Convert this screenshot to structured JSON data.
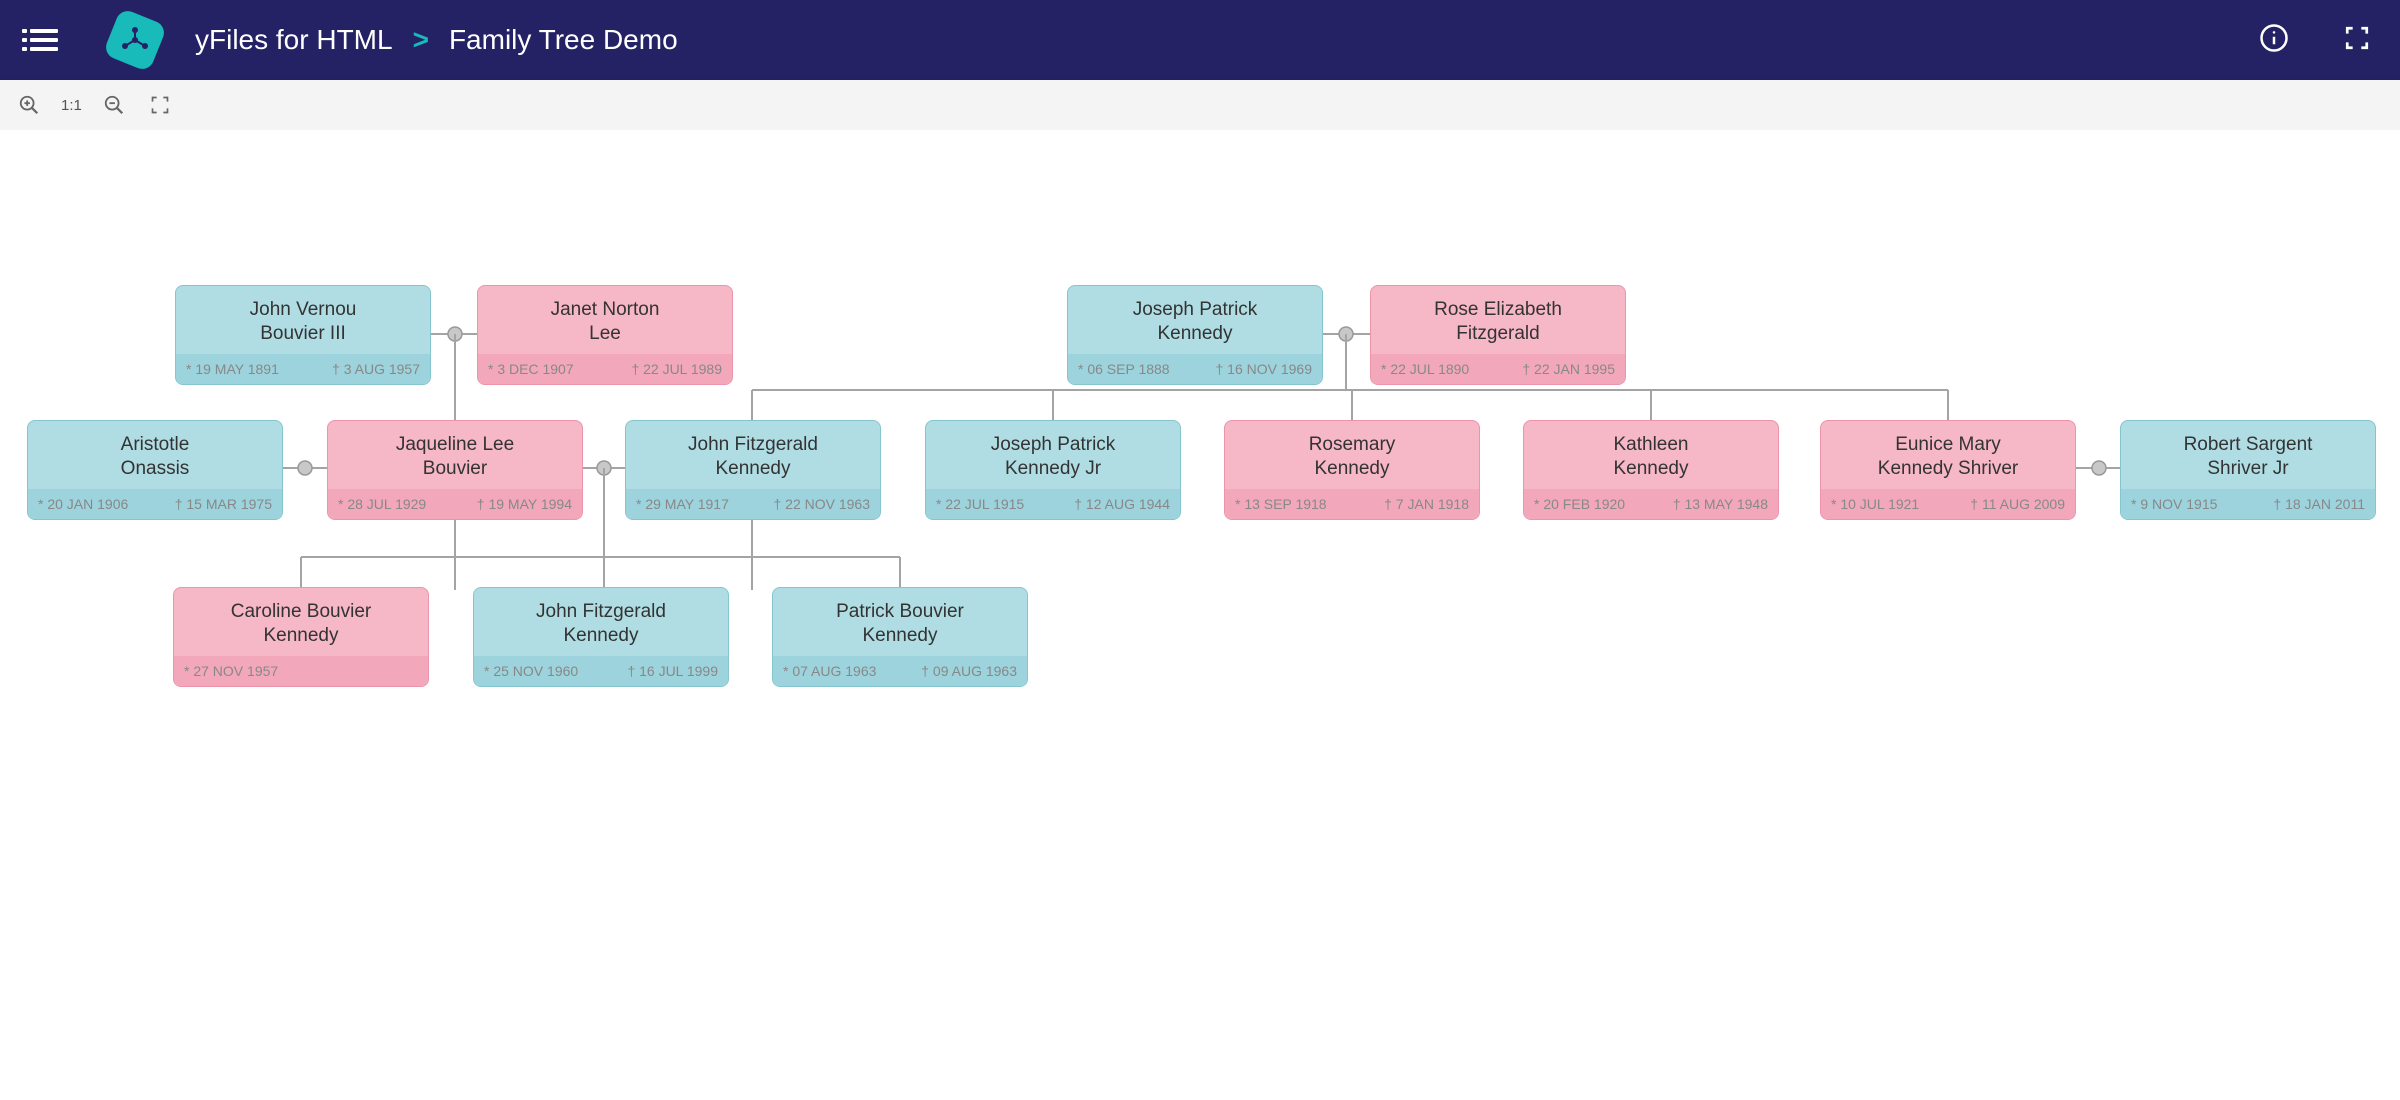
{
  "header": {
    "product": "yFiles for HTML",
    "separator": ">",
    "page": "Family Tree Demo"
  },
  "toolbar": {
    "zoom_reset": "1:1"
  },
  "people": {
    "john_bouvier": {
      "name1": "John Vernou",
      "name2": "Bouvier III",
      "birth": "* 19 MAY 1891",
      "death": "† 3 AUG 1957"
    },
    "janet_lee": {
      "name1": "Janet Norton",
      "name2": "Lee",
      "birth": "* 3 DEC 1907",
      "death": "† 22 JUL 1989"
    },
    "joseph_kennedy_sr": {
      "name1": "Joseph Patrick",
      "name2": "Kennedy",
      "birth": "* 06 SEP 1888",
      "death": "† 16 NOV 1969"
    },
    "rose_fitzgerald": {
      "name1": "Rose Elizabeth",
      "name2": "Fitzgerald",
      "birth": "* 22 JUL 1890",
      "death": "† 22 JAN 1995"
    },
    "aristotle_onassis": {
      "name1": "Aristotle",
      "name2": "Onassis",
      "birth": "* 20 JAN 1906",
      "death": "† 15 MAR 1975"
    },
    "jackie": {
      "name1": "Jaqueline Lee",
      "name2": "Bouvier",
      "birth": "* 28 JUL 1929",
      "death": "† 19 MAY 1994"
    },
    "jfk": {
      "name1": "John Fitzgerald",
      "name2": "Kennedy",
      "birth": "* 29 MAY 1917",
      "death": "† 22 NOV 1963"
    },
    "joe_jr": {
      "name1": "Joseph Patrick",
      "name2": "Kennedy Jr",
      "birth": "* 22 JUL 1915",
      "death": "† 12 AUG 1944"
    },
    "rosemary": {
      "name1": "Rosemary",
      "name2": "Kennedy",
      "birth": "* 13 SEP 1918",
      "death": "† 7 JAN 1918"
    },
    "kathleen": {
      "name1": "Kathleen",
      "name2": "Kennedy",
      "birth": "* 20 FEB 1920",
      "death": "† 13 MAY 1948"
    },
    "eunice": {
      "name1": "Eunice Mary",
      "name2": "Kennedy Shriver",
      "birth": "* 10 JUL 1921",
      "death": "† 11 AUG 2009"
    },
    "shriver": {
      "name1": "Robert Sargent",
      "name2": "Shriver Jr",
      "birth": "* 9 NOV 1915",
      "death": "† 18 JAN 2011"
    },
    "caroline": {
      "name1": "Caroline Bouvier",
      "name2": "Kennedy",
      "birth": "* 27 NOV 1957",
      "death": ""
    },
    "jfk_jr": {
      "name1": "John Fitzgerald",
      "name2": "Kennedy",
      "birth": "* 25 NOV 1960",
      "death": "† 16 JUL 1999"
    },
    "patrick": {
      "name1": "Patrick Bouvier",
      "name2": "Kennedy",
      "birth": "* 07 AUG 1963",
      "death": "† 09 AUG 1963"
    }
  }
}
